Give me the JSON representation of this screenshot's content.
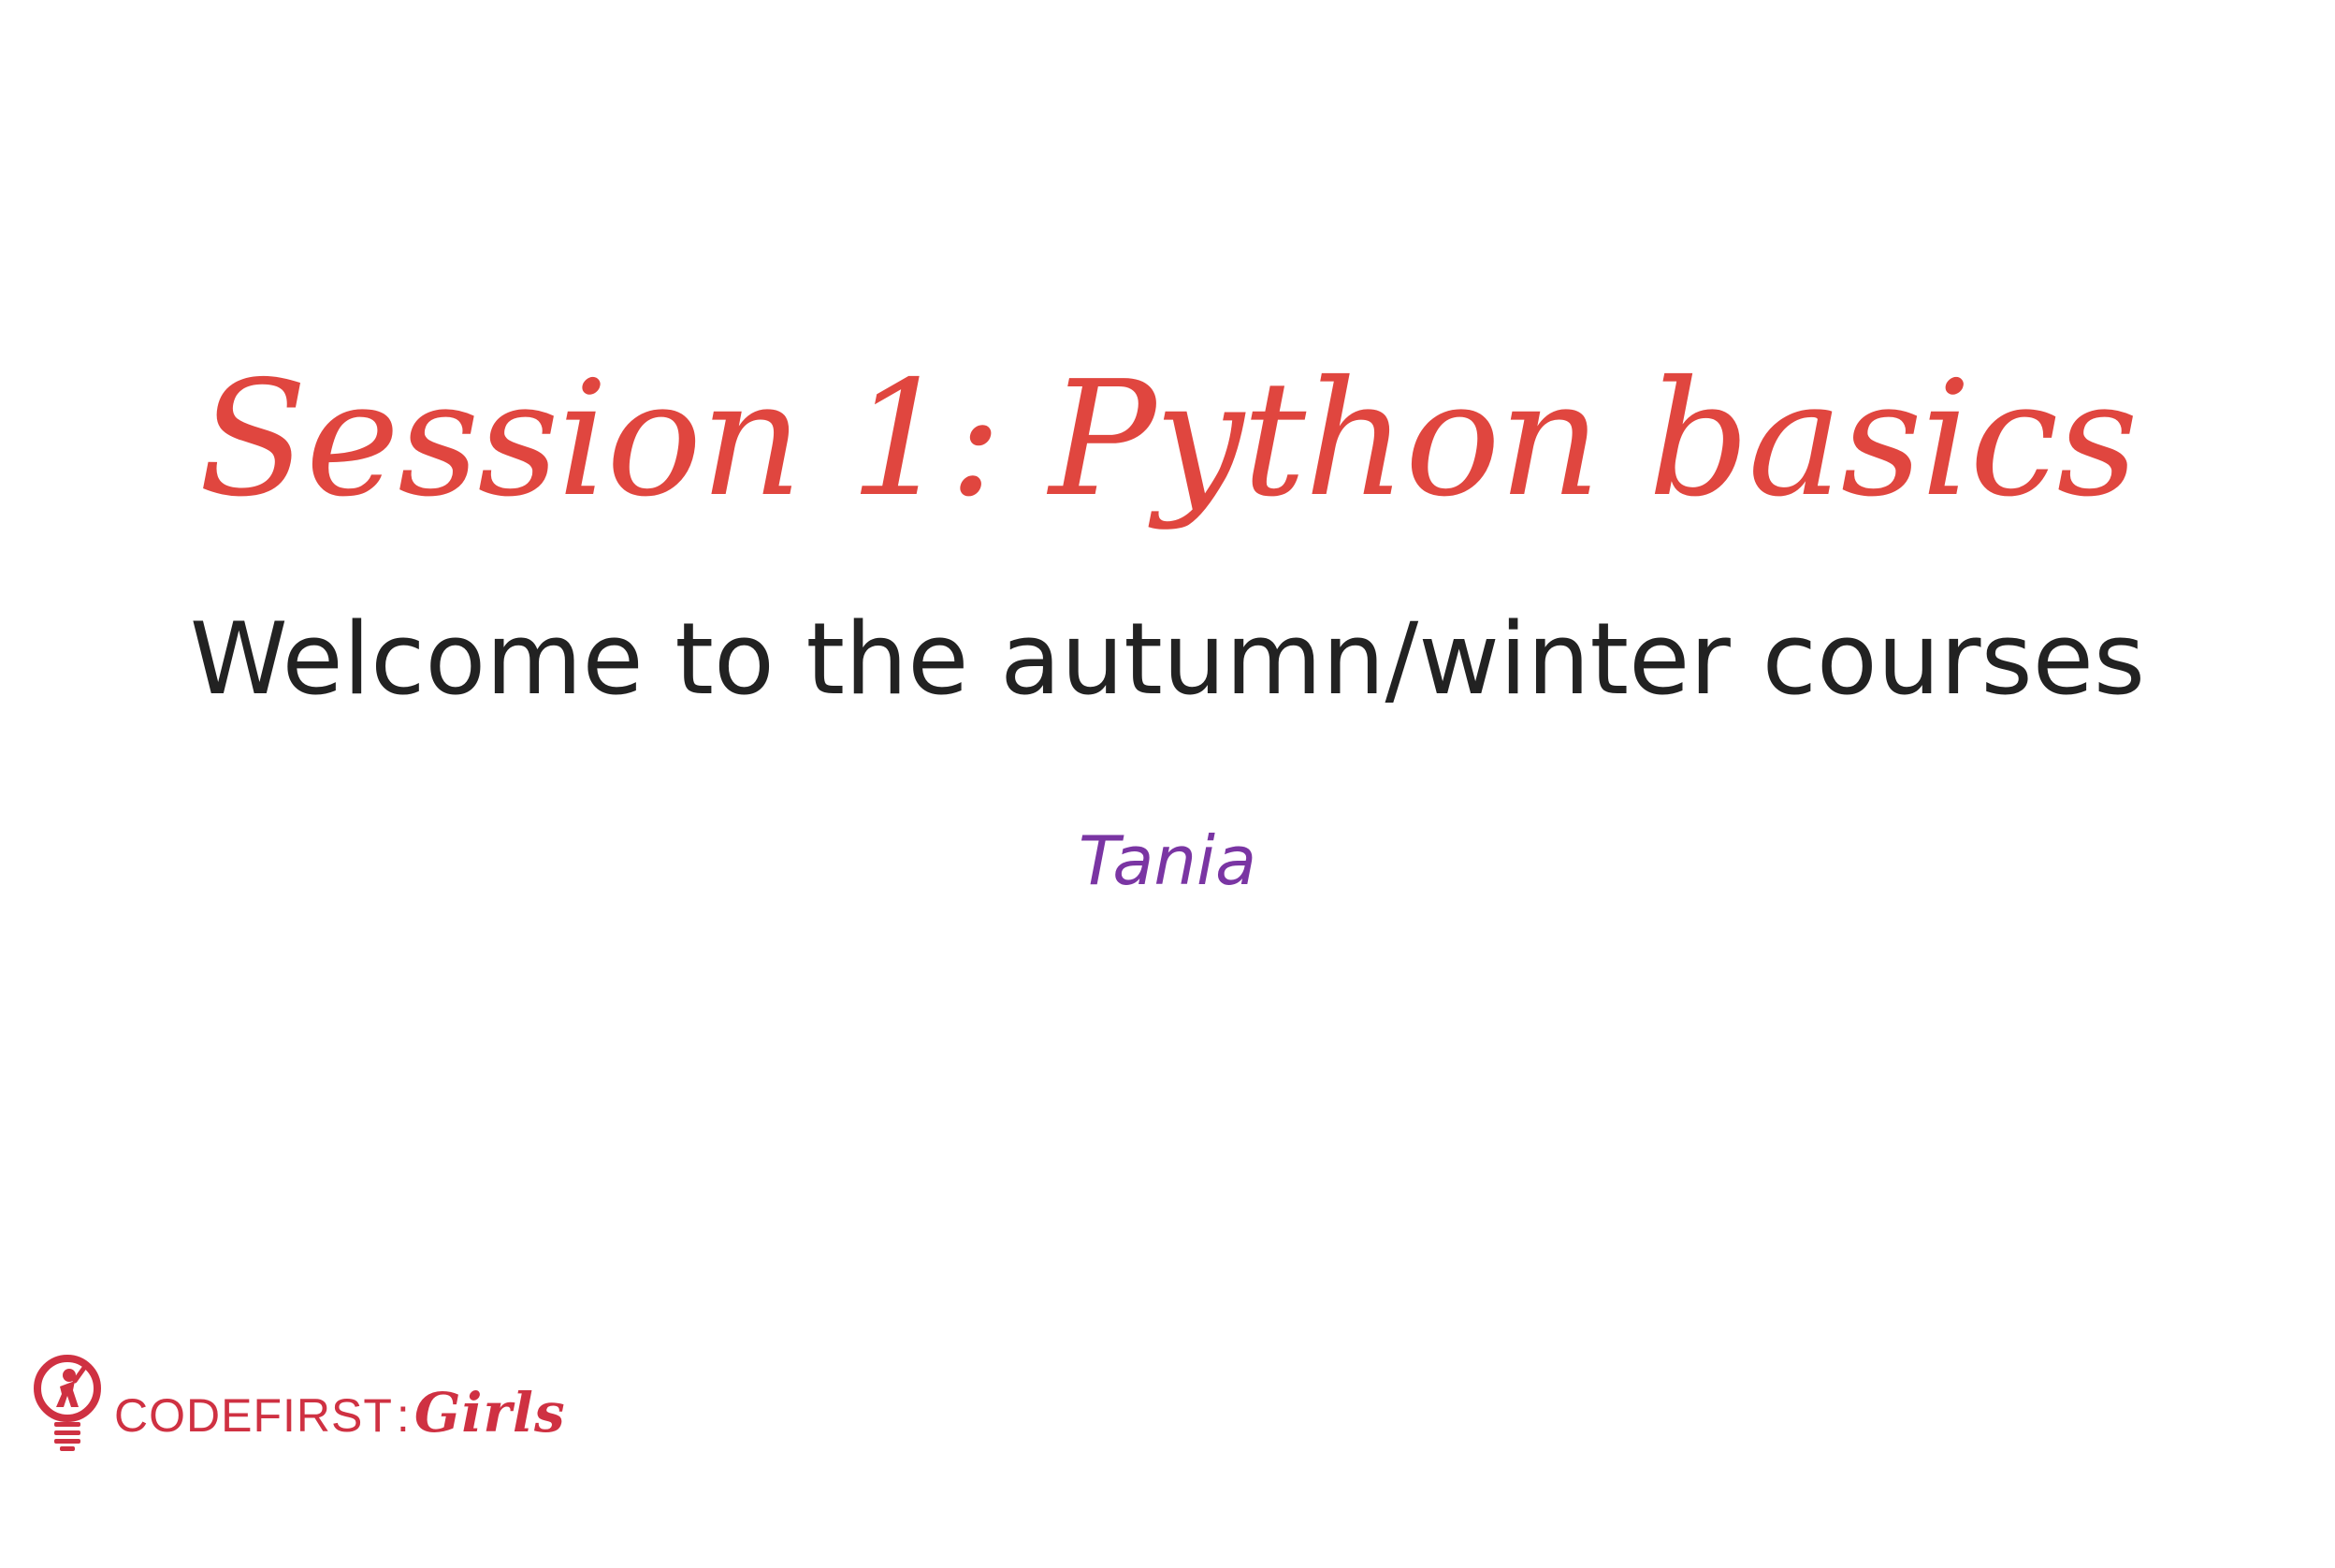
{
  "slide": {
    "title": "Session 1: Python basics",
    "subtitle": "Welcome to the autumn/winter courses",
    "author": "Tania"
  },
  "logo": {
    "name_part1": "CODEFIRST",
    "separator": ":",
    "name_part2": "Girls",
    "icon": "lightbulb-person-icon"
  },
  "colors": {
    "title": "#e0463f",
    "subtitle": "#222222",
    "author": "#7a35a3",
    "brand": "#cf3142",
    "background": "#ffffff"
  }
}
